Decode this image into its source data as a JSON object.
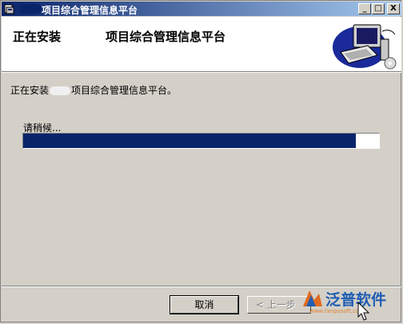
{
  "titlebar": {
    "title": "项目综合管理信息平台",
    "minimize": "_",
    "maximize": "□",
    "close": "X"
  },
  "header": {
    "heading": "正在安装",
    "product_name": "项目综合管理信息平台"
  },
  "body": {
    "status_prefix": "正在安装",
    "status_suffix": "项目综合管理信息平台。",
    "wait_label": "请稍候...",
    "progress_fraction": 0.935
  },
  "buttons": {
    "cancel": "取消",
    "back": "< 上一步"
  },
  "watermark": {
    "text": "泛普软件",
    "url": "www.fanpusoft.com"
  },
  "colors": {
    "title_bar": "#0a246a",
    "progress_fill": "#0a246a",
    "dialog_bg": "#d4d0c8",
    "watermark": "#1f5db3"
  }
}
